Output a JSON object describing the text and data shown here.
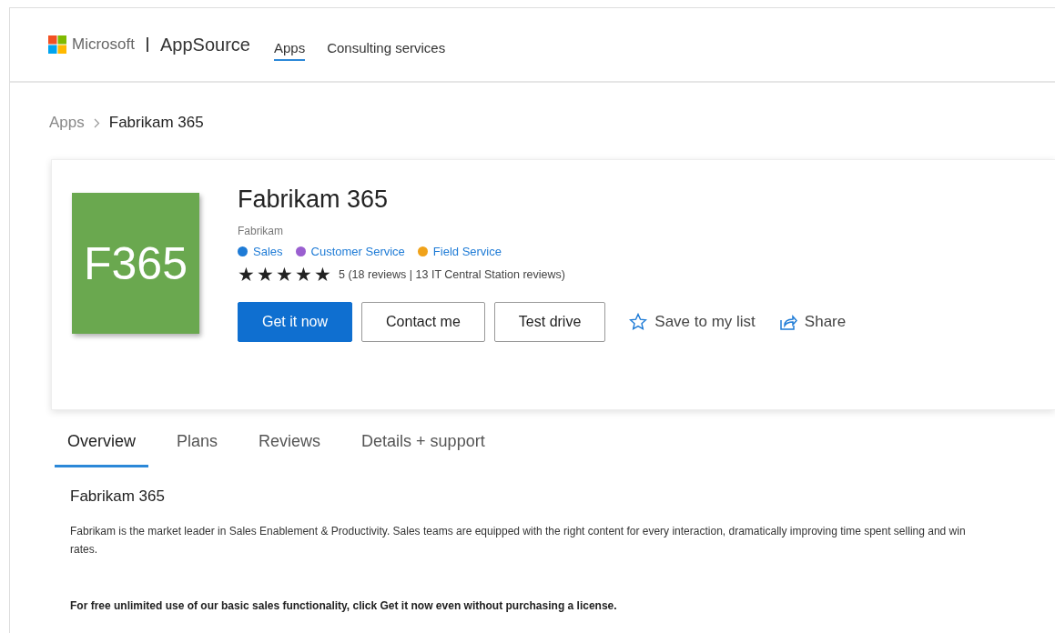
{
  "header": {
    "brand": "Microsoft",
    "product": "AppSource",
    "nav": [
      {
        "label": "Apps",
        "selected": true
      },
      {
        "label": "Consulting services",
        "selected": false
      }
    ]
  },
  "breadcrumb": {
    "parent": "Apps",
    "current": "Fabrikam 365"
  },
  "app": {
    "logo_text": "F365",
    "title": "Fabrikam 365",
    "publisher": "Fabrikam",
    "categories": [
      {
        "label": "Sales",
        "color": "#1e7bd6"
      },
      {
        "label": "Customer Service",
        "color": "#9a5fd0"
      },
      {
        "label": "Field Service",
        "color": "#f0a21a"
      }
    ],
    "stars": 5,
    "rating_text": "5 (18 reviews | 13 IT Central Station reviews)",
    "buttons": [
      {
        "label": "Get it now",
        "kind": "primary"
      },
      {
        "label": "Contact me",
        "kind": "secondary"
      },
      {
        "label": "Test drive",
        "kind": "secondary"
      }
    ],
    "actions": [
      {
        "label": "Save to my list",
        "kind": "save"
      },
      {
        "label": "Share",
        "kind": "share"
      }
    ]
  },
  "tabs": [
    {
      "label": "Overview",
      "selected": true
    },
    {
      "label": "Plans",
      "selected": false
    },
    {
      "label": "Reviews",
      "selected": false
    },
    {
      "label": "Details + support",
      "selected": false
    }
  ],
  "overview": {
    "heading": "Fabrikam 365",
    "description": "Fabrikam is the market leader in Sales Enablement & Productivity. Sales teams are equipped with the right content for every interaction, dramatically improving time spent selling and win rates.",
    "note": "For free unlimited use of our basic sales functionality, click Get it now even without purchasing a license."
  }
}
